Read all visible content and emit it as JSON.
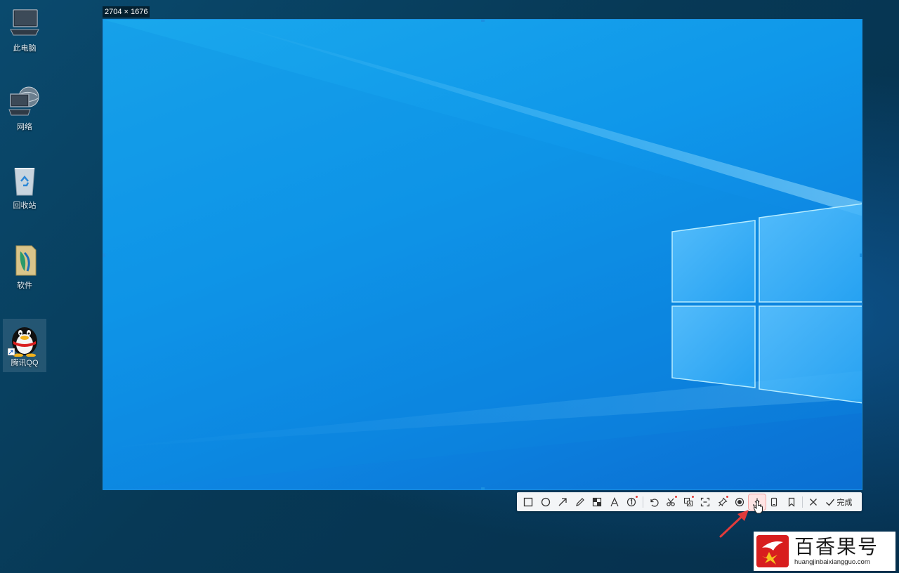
{
  "desktop": {
    "icons": [
      {
        "label": "此电脑",
        "icon": "computer-icon"
      },
      {
        "label": "网络",
        "icon": "network-icon"
      },
      {
        "label": "回收站",
        "icon": "recycle-bin-icon"
      },
      {
        "label": "软件",
        "icon": "folder-icon"
      },
      {
        "label": "腾讯QQ",
        "icon": "qq-penguin-icon"
      }
    ]
  },
  "selection": {
    "size_label": "2704 × 1676"
  },
  "toolbar": {
    "tools": [
      {
        "name": "rectangle",
        "icon": "rectangle-icon"
      },
      {
        "name": "ellipse",
        "icon": "ellipse-icon"
      },
      {
        "name": "arrow",
        "icon": "arrow-icon"
      },
      {
        "name": "pencil",
        "icon": "pencil-icon"
      },
      {
        "name": "mosaic",
        "icon": "mosaic-icon"
      },
      {
        "name": "text",
        "icon": "text-icon"
      },
      {
        "name": "number",
        "icon": "number-icon"
      },
      {
        "name": "undo",
        "icon": "undo-icon"
      },
      {
        "name": "long-screenshot",
        "icon": "scissors-icon"
      },
      {
        "name": "translate",
        "icon": "translate-icon"
      },
      {
        "name": "ocr",
        "icon": "ocr-icon"
      },
      {
        "name": "pin",
        "icon": "pin-icon"
      },
      {
        "name": "record",
        "icon": "record-icon"
      },
      {
        "name": "save",
        "icon": "download-icon"
      },
      {
        "name": "phone",
        "icon": "phone-icon"
      },
      {
        "name": "bookmark",
        "icon": "bookmark-icon"
      },
      {
        "name": "close",
        "icon": "close-icon"
      }
    ],
    "done_label": "完成",
    "accent": "#e23b3b"
  },
  "watermark": {
    "title": "百香果号",
    "url": "huangjinbaixiangguo.com"
  },
  "colors": {
    "desktop": "#063a5c",
    "wallpaper": "#0f97ea",
    "selection_border": "#1a8fe0",
    "annotation_arrow": "#e23b3b"
  }
}
